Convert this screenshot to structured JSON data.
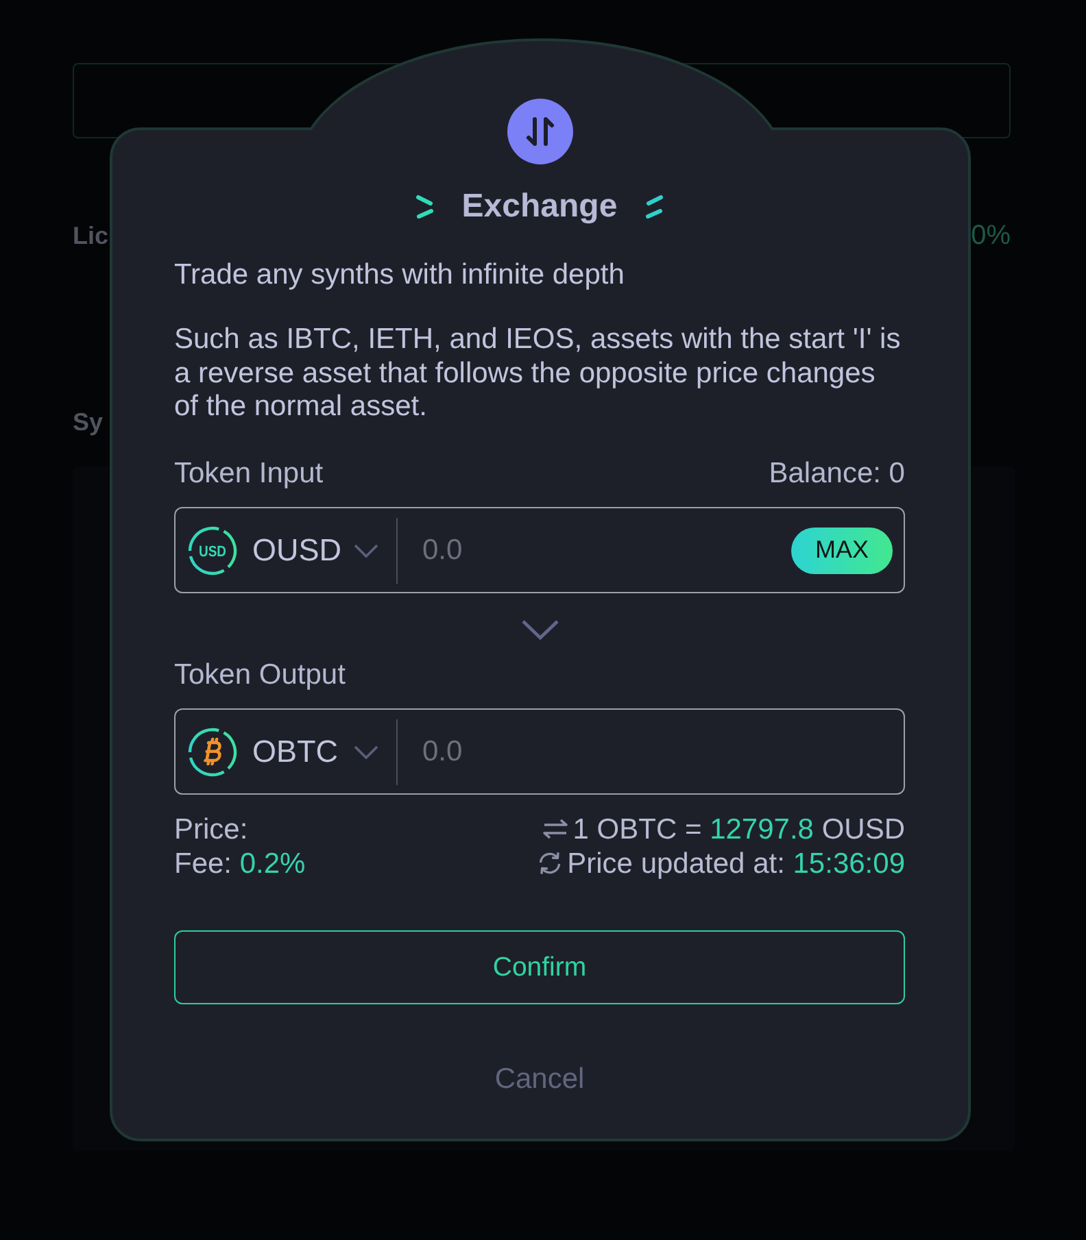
{
  "background": {
    "title_1": "Lic",
    "stat": "0%",
    "title_2": "Sy"
  },
  "dialog": {
    "title": "Exchange",
    "intro": "Trade any synths with infinite depth",
    "description": "Such as IBTC, IETH, and IEOS, assets with the start 'I' is a reverse asset that follows the opposite price changes of the normal asset.",
    "input": {
      "label": "Token Input",
      "balance": "Balance: 0",
      "token": "OUSD",
      "coin_mark": "USD",
      "placeholder": "0.0",
      "max_button": "MAX"
    },
    "output": {
      "label": "Token Output",
      "token": "OBTC",
      "placeholder": "0.0"
    },
    "price": {
      "label": "Price:",
      "rate_prefix": "1 OBTC =",
      "rate_value": "12797.8",
      "rate_suffix": "OUSD"
    },
    "fee": {
      "label": "Fee:",
      "value": "0.2%"
    },
    "updated": {
      "label": "Price updated at:",
      "time": "15:36:09"
    },
    "buttons": {
      "confirm": "Confirm",
      "cancel": "Cancel"
    }
  }
}
